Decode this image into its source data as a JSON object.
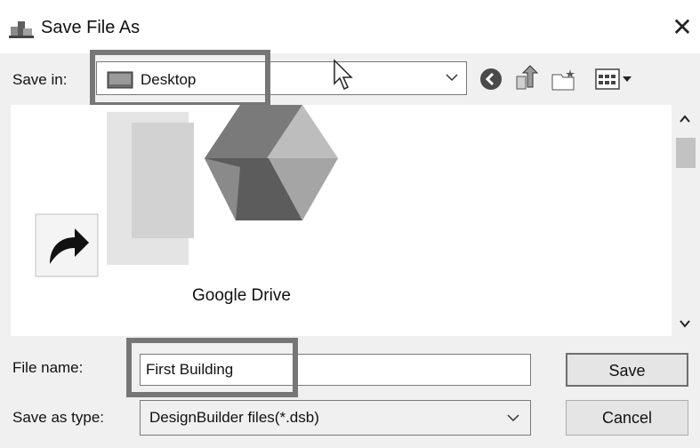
{
  "window": {
    "title": "Save File As",
    "title_icon": "save-file-app-icon",
    "close_glyph": "✕"
  },
  "toolbar": {
    "save_in_label": "Save in:",
    "save_in_value": "Desktop",
    "save_in_icon": "desktop-folder-icon",
    "buttons": [
      "back-icon",
      "up-folder-icon",
      "new-folder-icon",
      "views-menu-icon"
    ]
  },
  "file_list": {
    "items": [
      {
        "label": "Google Drive",
        "icon": "google-drive-icon"
      },
      {
        "label": "",
        "icon": "shortcut-arrow-icon"
      }
    ]
  },
  "form": {
    "file_name_label": "File name:",
    "file_name_value": "First Building",
    "save_as_type_label": "Save as type:",
    "save_as_type_value": "DesignBuilder files(*.dsb)"
  },
  "actions": {
    "save_label": "Save",
    "cancel_label": "Cancel"
  },
  "colors": {
    "highlight_frame": "#767676",
    "window_bg": "#f0f0f0"
  }
}
